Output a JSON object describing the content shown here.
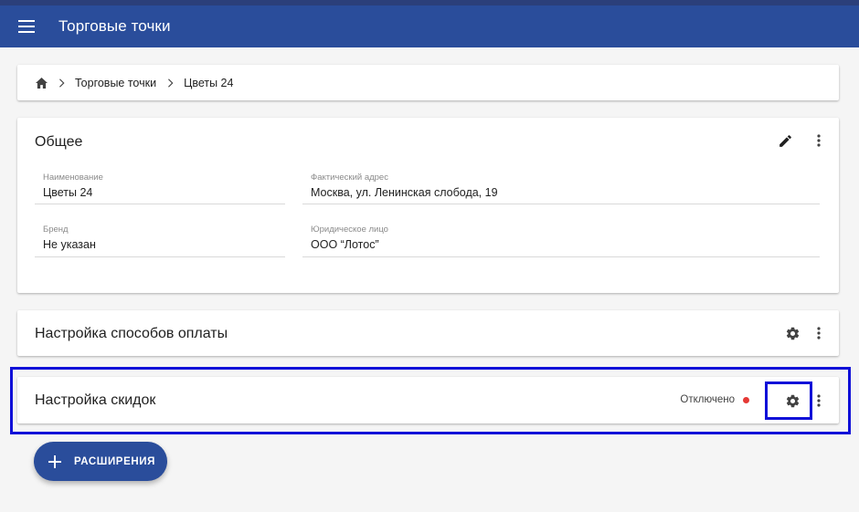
{
  "header": {
    "title": "Торговые точки",
    "menu_icon": "menu-icon"
  },
  "breadcrumb": {
    "items": [
      "Торговые точки",
      "Цветы 24"
    ],
    "home_icon": "home-icon",
    "separator_icon": "chevron-right-icon"
  },
  "general": {
    "title": "Общее",
    "fields": {
      "name": {
        "label": "Наименование",
        "value": "Цветы 24"
      },
      "address": {
        "label": "Фактический адрес",
        "value": "Москва, ул. Ленинская слобода, 19"
      },
      "brand": {
        "label": "Бренд",
        "value": "Не указан"
      },
      "legal": {
        "label": "Юридическое лицо",
        "value": "ООО “Лотос”"
      }
    }
  },
  "payments": {
    "title": "Настройка способов оплаты"
  },
  "discounts": {
    "title": "Настройка скидок",
    "status": "Отключено",
    "status_color": "#e53935"
  },
  "fab": {
    "label": "РАСШИРЕНИЯ"
  },
  "colors": {
    "primary": "#2a4d9b",
    "highlight": "#1010d8"
  }
}
